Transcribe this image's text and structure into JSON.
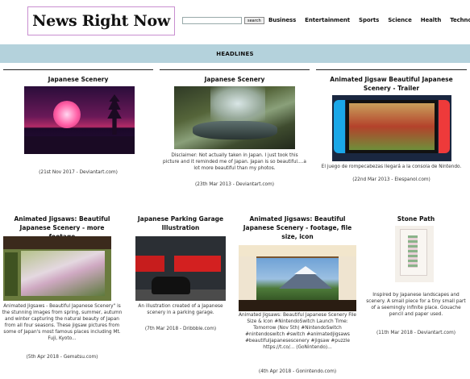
{
  "site": {
    "logo": "News Right Now",
    "search_placeholder": "",
    "search_button": "search"
  },
  "nav": {
    "items": [
      "Business",
      "Entertainment",
      "Sports",
      "Science",
      "Health",
      "Technology"
    ]
  },
  "headlines_label": "HEADLINES",
  "cards": [
    {
      "title": "Japanese Scenery",
      "description": "",
      "meta": "(21st Nov 2017 - Deviantart.com)"
    },
    {
      "title": "Japanese Scenery",
      "description": "Disclaimer: Not actually taken in Japan. I just took this picture and it reminded me of Japan. Japan is so beautiful....a lot more beautiful than my photos.",
      "meta": "(23th Mar 2013 - Deviantart.com)"
    },
    {
      "title": "Animated Jigsaw Beautiful Japanese Scenery - Trailer",
      "description": "El juego de rompecabezas llegará a la consola de Nintendo.",
      "meta": "(22nd Mar 2013 - Elespanol.com)"
    },
    {
      "title": "Animated Jigsaws: Beautiful Japanese Scenery - more footage",
      "description": "Animated Jigsaws - Beautiful Japanese Scenery\" is the stunning images from spring, summer, autumn and winter capturing the natural beauty of Japan from all four seasons. These jigsaw pictures from some of Japan's most famous places including Mt. Fuji, Kyoto...",
      "meta": "(5th Apr 2018 - Gematsu.com)"
    },
    {
      "title": "Japanese Parking Garage Illustration",
      "description": "An illustration created of a Japanese scenery in a parking garage.",
      "meta": "(7th Mar 2018 - Dribbble.com)"
    },
    {
      "title": "Animated Jigsaws: Beautiful Japanese Scenery - footage, file size, icon",
      "description": "Animated Jigsaws: Beautiful Japanese Scenery File Size & Icon #NintendoSwitch Launch Time: Tomorrow (Nov 5th) #NintendoSwitch #nintendoswitch #switch #animatedjigsaws #beautifuljapanesescenery #jigsaw #puzzle https://t.co/... (GoNintendo)...",
      "meta": "(4th Apr 2018 - Gonintendo.com)"
    },
    {
      "title": "Stone Path",
      "description": "Inspired by Japanese landscapes and scenery. A small piece for a tiny small part of a seemingly infinite place. Gouache pencil and paper used.",
      "meta": "(11th Mar 2018 - Deviantart.com)"
    }
  ]
}
